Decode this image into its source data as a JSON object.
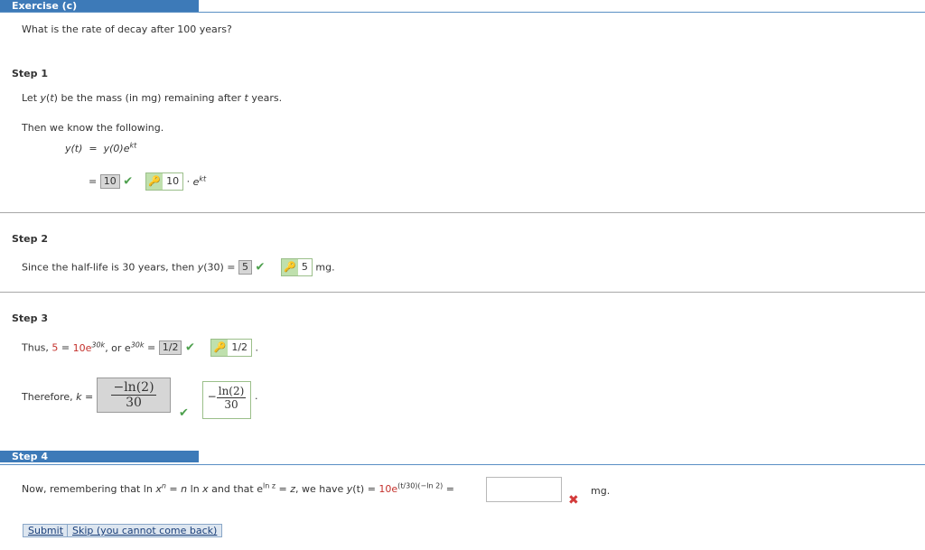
{
  "exercise": {
    "tab_label": "Exercise (c)",
    "question": "What is the rate of decay after 100 years?"
  },
  "step1": {
    "label": "Step 1",
    "intro": [
      "Let ",
      "y",
      "(",
      "t",
      ") be the mass (in mg) remaining after ",
      "t",
      " years."
    ],
    "then": "Then we know the following.",
    "eq_lhs": "y(t)",
    "eq_eq": "=",
    "eq_rhs_base": "y(0)e",
    "eq_rhs_exp": "kt",
    "line2_eq": "=",
    "answer": "10",
    "correct": "10",
    "times": "·",
    "e": "e",
    "e_exp": "kt"
  },
  "step2": {
    "label": "Step 2",
    "text_pre": "Since the half-life is 30 years, then ",
    "fn": "y",
    "fn_arg": "(30) =",
    "answer": "5",
    "correct": "5",
    "unit": "mg."
  },
  "step3": {
    "label": "Step 3",
    "thus": "Thus,",
    "five": "5",
    "eq1": "=",
    "ten_e": "10e",
    "exp1": "30k",
    "or": ", or e",
    "exp2": "30k",
    "eq2": "=",
    "answer": "1/2",
    "correct": "1/2",
    "period": ".",
    "therefore": "Therefore,",
    "k": "k",
    "k_eq": "=",
    "k_ans_num": "−ln(2)",
    "k_ans_den": "30",
    "k_neg": "−",
    "k_cor_num": "ln(2)",
    "k_cor_den": "30",
    "period2": "."
  },
  "step4": {
    "tab_label": "Step 4",
    "now": "Now, remembering that  ln ",
    "x": "x",
    "n": "n",
    "eq_a": " = ",
    "n2": "n",
    "ln_x": " ln ",
    "x2": "x",
    "and_that": "  and that  e",
    "lnz": "ln z",
    "eq_b": " = ",
    "z": "z",
    "comma": ",  we have  ",
    "y": "y",
    "yt": "(t) = ",
    "ten_e": "10e",
    "exponent": "(t/30)(−ln 2)",
    "eq_c": " =",
    "unit": "mg.",
    "input_value": ""
  },
  "buttons": {
    "submit": "Submit",
    "skip": "Skip (you cannot come back)"
  },
  "colors": {
    "tab_blue": "#3d7ab8",
    "check_green": "#4da04d",
    "error_red": "#d33a3a",
    "given_red": "#c4302b"
  }
}
